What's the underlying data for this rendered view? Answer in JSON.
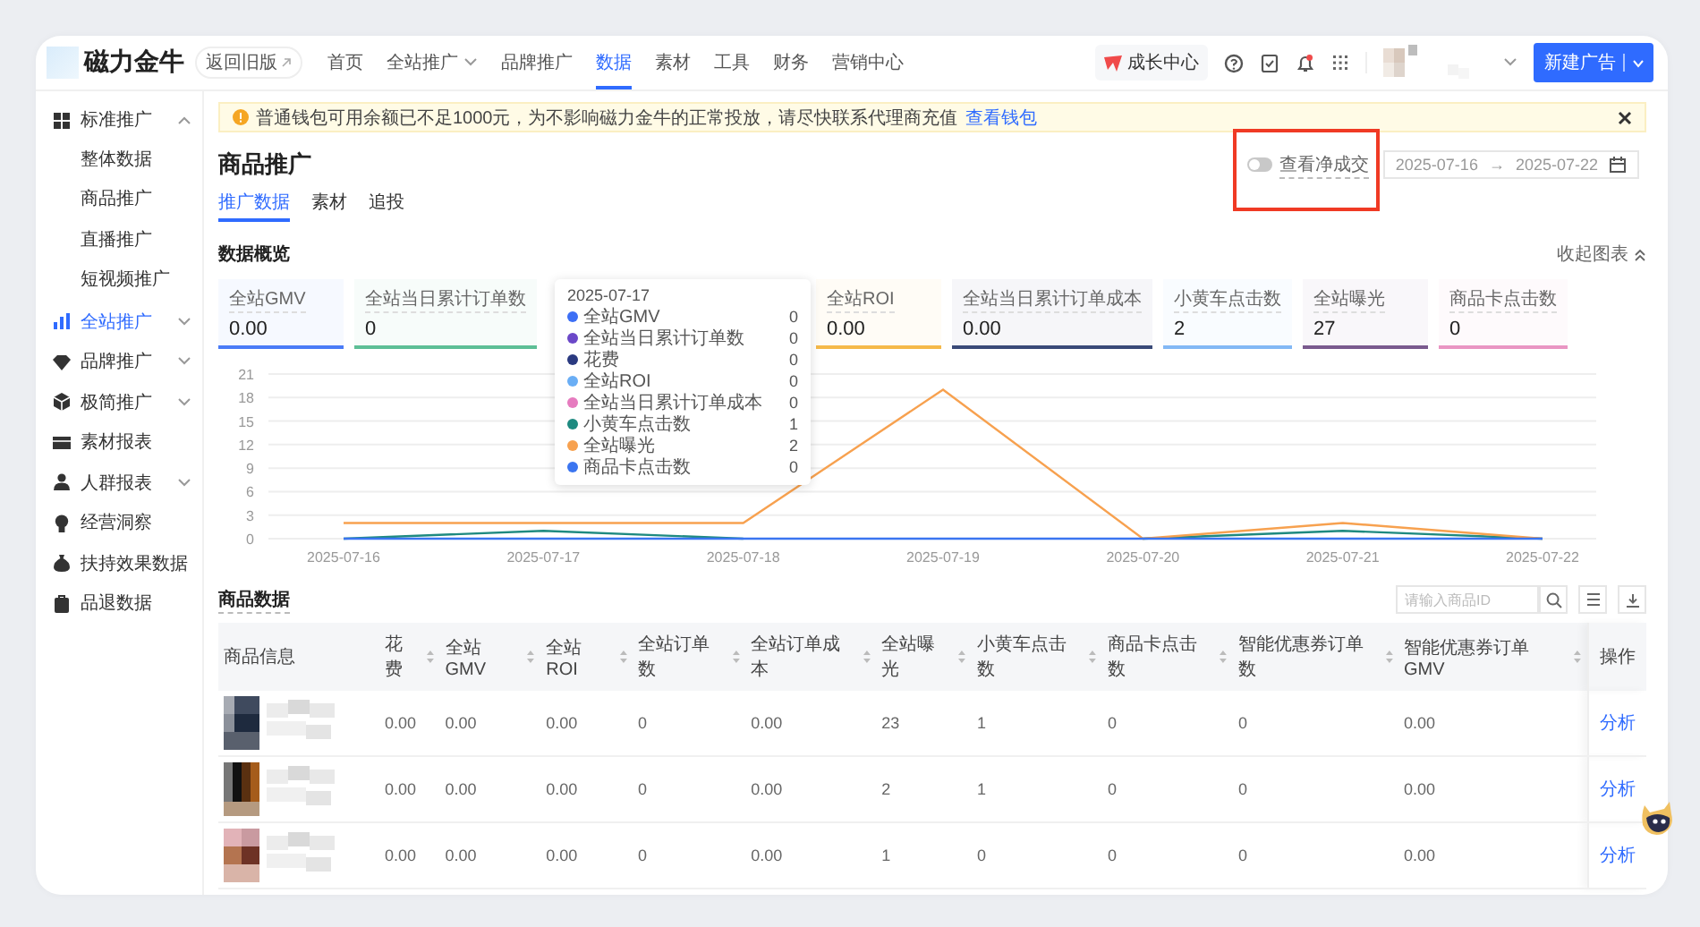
{
  "nav": {
    "logo_text": "磁力金牛",
    "back_button": "返回旧版",
    "items": [
      {
        "label": "首页",
        "selected": false,
        "dropdown": false
      },
      {
        "label": "全站推广",
        "selected": false,
        "dropdown": true
      },
      {
        "label": "品牌推广",
        "selected": false,
        "dropdown": false
      },
      {
        "label": "数据",
        "selected": true,
        "dropdown": false
      },
      {
        "label": "素材",
        "selected": false,
        "dropdown": false
      },
      {
        "label": "工具",
        "selected": false,
        "dropdown": false
      },
      {
        "label": "财务",
        "selected": false,
        "dropdown": false
      },
      {
        "label": "营销中心",
        "selected": false,
        "dropdown": false
      }
    ],
    "growth_center": "成长中心",
    "new_ad_button": "新建广告"
  },
  "sidebar": {
    "items": [
      {
        "label": "标准推广",
        "kind": "group",
        "selected": false,
        "expanded": true,
        "children": [
          {
            "label": "整体数据",
            "selected": false
          },
          {
            "label": "商品推广",
            "selected": false
          },
          {
            "label": "直播推广",
            "selected": false
          },
          {
            "label": "短视频推广",
            "selected": false
          }
        ]
      },
      {
        "label": "全站推广",
        "kind": "group",
        "selected": true,
        "expanded": false
      },
      {
        "label": "品牌推广",
        "kind": "group",
        "selected": false,
        "expanded": false
      },
      {
        "label": "极简推广",
        "kind": "group",
        "selected": false,
        "expanded": false
      },
      {
        "label": "素材报表",
        "kind": "link",
        "selected": false
      },
      {
        "label": "人群报表",
        "kind": "group",
        "selected": false,
        "expanded": false
      },
      {
        "label": "经营洞察",
        "kind": "link",
        "selected": false
      },
      {
        "label": "扶持效果数据",
        "kind": "link",
        "selected": false
      },
      {
        "label": "品退数据",
        "kind": "link",
        "selected": false
      }
    ]
  },
  "alert": {
    "text": "普通钱包可用余额已不足1000元，为不影响磁力金牛的正常投放，请尽快联系代理商充值",
    "link": "查看钱包"
  },
  "page": {
    "title": "商品推广",
    "tabs": [
      {
        "label": "推广数据",
        "selected": true
      },
      {
        "label": "素材",
        "selected": false
      },
      {
        "label": "追投",
        "selected": false
      }
    ],
    "net_deal_toggle": {
      "label": "查看净成交",
      "on": false,
      "highlighted": true
    },
    "date_range": {
      "start": "2025-07-16",
      "separator": "→",
      "end": "2025-07-22"
    }
  },
  "overview": {
    "title": "数据概览",
    "collapse_button": "收起图表",
    "cards": [
      {
        "label": "全站GMV",
        "value": "0.00",
        "color": "#4a7bf7"
      },
      {
        "label": "全站当日累计订单数",
        "value": "0",
        "color": "#5dbf96"
      },
      {
        "label": "全站ROI",
        "value": "0.00",
        "color": "#f5b94a"
      },
      {
        "label": "全站当日累计订单成本",
        "value": "0.00",
        "color": "#3a4a78"
      },
      {
        "label": "小黄车点击数",
        "value": "2",
        "color": "#83b8f5"
      },
      {
        "label": "全站曝光",
        "value": "27",
        "color": "#7a5a8e"
      },
      {
        "label": "商品卡点击数",
        "value": "0",
        "color": "#e995c3"
      }
    ],
    "tooltip": {
      "date": "2025-07-17",
      "values": [
        "0",
        "0",
        "0",
        "0",
        "0",
        "1",
        "2",
        "0"
      ]
    },
    "chart_data": {
      "type": "line",
      "grid": true,
      "categories": [
        "2025-07-16",
        "2025-07-17",
        "2025-07-18",
        "2025-07-19",
        "2025-07-20",
        "2025-07-21",
        "2025-07-22"
      ],
      "ylim": [
        0,
        21
      ],
      "yticks": [
        0,
        3,
        6,
        9,
        12,
        15,
        18,
        21
      ],
      "series": [
        {
          "name": "全站GMV",
          "color": "#3d6ff5",
          "values": [
            null,
            null,
            null,
            null,
            null,
            null,
            null
          ]
        },
        {
          "name": "全站当日累计订单数",
          "color": "#6b48c8",
          "values": [
            null,
            null,
            null,
            null,
            null,
            null,
            null
          ]
        },
        {
          "name": "花费",
          "color": "#2a3a80",
          "values": [
            null,
            null,
            null,
            null,
            null,
            null,
            null
          ]
        },
        {
          "name": "全站ROI",
          "color": "#6aaef5",
          "values": [
            null,
            null,
            null,
            null,
            null,
            null,
            null
          ]
        },
        {
          "name": "全站当日累计订单成本",
          "color": "#e67bbf",
          "values": [
            null,
            null,
            null,
            null,
            null,
            null,
            null
          ]
        },
        {
          "name": "小黄车点击数",
          "color": "#1e8a80",
          "values": [
            0,
            1,
            0,
            null,
            0,
            1,
            0
          ]
        },
        {
          "name": "全站曝光",
          "color": "#f7a14f",
          "values": [
            2,
            2,
            2,
            19,
            0,
            2,
            0
          ]
        },
        {
          "name": "商品卡点击数",
          "color": "#3b75f0",
          "values": [
            0,
            0,
            0,
            0,
            0,
            0,
            0
          ]
        }
      ]
    }
  },
  "products": {
    "title": "商品数据",
    "search_placeholder": "请输入商品ID",
    "columns": [
      {
        "label": "商品信息",
        "sortable": false
      },
      {
        "label": "花费",
        "sortable": true
      },
      {
        "label": "全站GMV",
        "sortable": true
      },
      {
        "label": "全站ROI",
        "sortable": true
      },
      {
        "label": "全站订单数",
        "sortable": true
      },
      {
        "label": "全站订单成本",
        "sortable": true
      },
      {
        "label": "全站曝光",
        "sortable": true
      },
      {
        "label": "小黄车点击数",
        "sortable": true
      },
      {
        "label": "商品卡点击数",
        "sortable": true
      },
      {
        "label": "智能优惠券订单数",
        "sortable": true
      },
      {
        "label": "智能优惠券订单GMV",
        "sortable": true
      },
      {
        "label": "操作",
        "sortable": false
      }
    ],
    "rows": [
      {
        "values": [
          "0.00",
          "0.00",
          "0.00",
          "0",
          "0.00",
          "23",
          "1",
          "0",
          "0",
          "0.00"
        ],
        "action": "分析"
      },
      {
        "values": [
          "0.00",
          "0.00",
          "0.00",
          "0",
          "0.00",
          "2",
          "1",
          "0",
          "0",
          "0.00"
        ],
        "action": "分析"
      },
      {
        "values": [
          "0.00",
          "0.00",
          "0.00",
          "0",
          "0.00",
          "1",
          "0",
          "0",
          "0",
          "0.00"
        ],
        "action": "分析"
      }
    ]
  }
}
